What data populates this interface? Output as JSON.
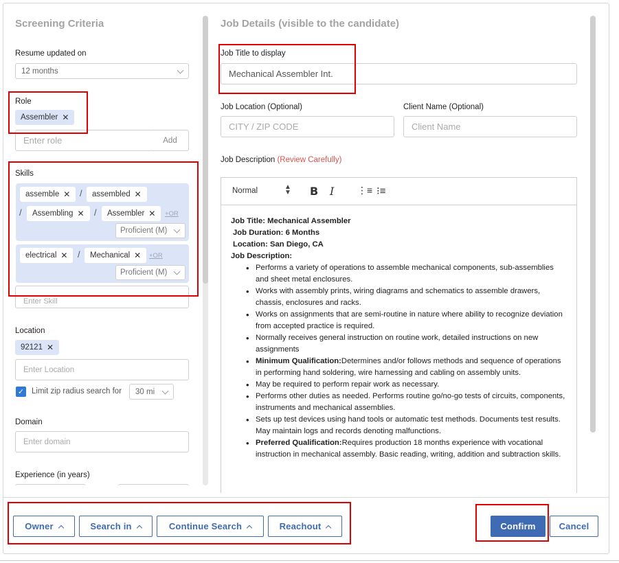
{
  "screening": {
    "title": "Screening Criteria",
    "resume_label": "Resume updated on",
    "resume_value": "12 months",
    "role_label": "Role",
    "role_chip": "Assembler",
    "role_placeholder": "Enter role",
    "add_label": "Add",
    "skills_label": "Skills",
    "skill_group_1": [
      "assemble",
      "assembled",
      "Assembling",
      "Assembler"
    ],
    "skill_group_2": [
      "electrical",
      "Mechanical"
    ],
    "or_label": "+OR",
    "proficiency": "Proficient (M)",
    "skill_placeholder": "Enter Skill",
    "location_label": "Location",
    "location_chip": "92121",
    "location_placeholder": "Enter Location",
    "zip_label": "Limit zip radius search for",
    "zip_radius": "30 mi",
    "domain_label": "Domain",
    "domain_placeholder": "Enter domain",
    "experience_label": "Experience (in years)"
  },
  "job": {
    "title": "Job Details (visible to the candidate)",
    "title_label": "Job Title to display",
    "title_value": "Mechanical Assembler Int.",
    "location_label": "Job Location (Optional)",
    "location_placeholder": "CITY / ZIP CODE",
    "client_label": "Client Name (Optional)",
    "client_placeholder": "Client Name",
    "desc_label": "Job Description",
    "desc_note": "(Review Carefully)",
    "toolbar_style": "Normal",
    "lines": {
      "title": "Job Title: Mechanical Assembler",
      "duration": "Job Duration: 6 Months",
      "location": "Location: San Diego, CA",
      "desc_head": "Job Description:"
    },
    "bullets": [
      {
        "bold": "",
        "text": "Performs a variety of operations to assemble mechanical components, sub-assemblies and sheet metal enclosures."
      },
      {
        "bold": "",
        "text": "Works with assembly prints, wiring diagrams and schematics to assemble drawers, chassis, enclosures and racks."
      },
      {
        "bold": "",
        "text": "Works on assignments that are semi-routine in nature where ability to recognize deviation from accepted practice is required."
      },
      {
        "bold": "",
        "text": "Normally receives general instruction on routine work, detailed instructions on new assignments"
      },
      {
        "bold": "Minimum Qualification:",
        "text": "Determines and/or follows methods and sequence of operations in performing hand soldering, wire harnessing and cabling on assembly units."
      },
      {
        "bold": "",
        "text": "May be required to perform repair work as necessary."
      },
      {
        "bold": "",
        "text": "Performs other duties as needed. Performs routine go/no-go tests of circuits, components, instruments and mechanical assemblies."
      },
      {
        "bold": "",
        "text": "Sets up test devices using hand tools or automatic test methods. Documents test results. May maintain logs and records denoting malfunctions."
      },
      {
        "bold": "Preferred Qualification:",
        "text": "Requires production 18 months experience with vocational instruction in mechanical assembly. Basic reading, writing, addition and subtraction skills."
      }
    ]
  },
  "footer": {
    "owner": "Owner",
    "search_in": "Search in",
    "continue_search": "Continue Search",
    "reachout": "Reachout",
    "confirm": "Confirm",
    "cancel": "Cancel"
  },
  "colors": {
    "accent": "#3f6ab4",
    "chip": "#dbe5f7",
    "highlight": "#e10000",
    "warning_text": "#d9534f"
  }
}
